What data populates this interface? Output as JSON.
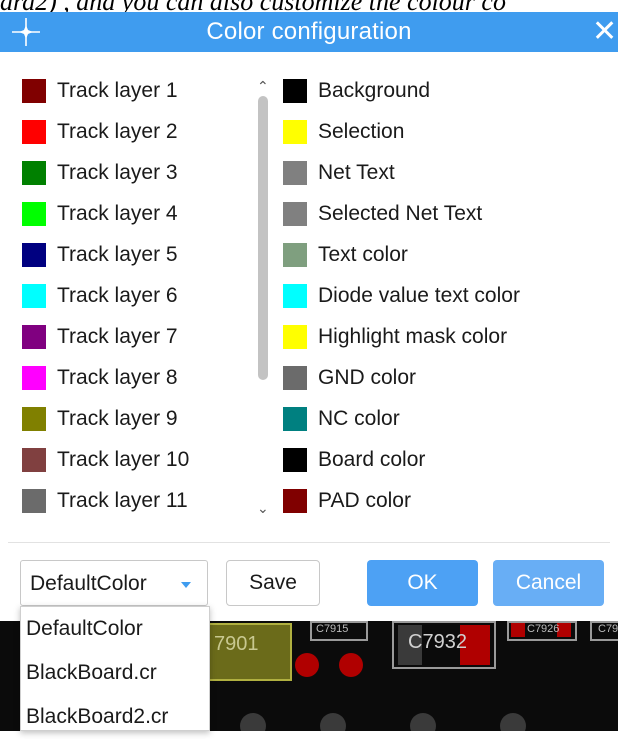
{
  "doc_text": "ard2) , and you can also customize the colour co",
  "window": {
    "title": "Color configuration",
    "close_glyph": "✕",
    "logo_icon": "crosshair-star-icon"
  },
  "left_items": [
    {
      "label": "Track layer 1",
      "color": "#800000"
    },
    {
      "label": "Track layer 2",
      "color": "#ff0000"
    },
    {
      "label": "Track layer 3",
      "color": "#008000"
    },
    {
      "label": "Track layer 4",
      "color": "#00ff00"
    },
    {
      "label": "Track layer 5",
      "color": "#000080"
    },
    {
      "label": "Track layer 6",
      "color": "#00ffff"
    },
    {
      "label": "Track layer 7",
      "color": "#800080"
    },
    {
      "label": "Track layer 8",
      "color": "#ff00ff"
    },
    {
      "label": "Track layer 9",
      "color": "#808000"
    },
    {
      "label": "Track layer 10",
      "color": "#804040"
    },
    {
      "label": "Track layer 11",
      "color": "#6b6b6b"
    }
  ],
  "right_items": [
    {
      "label": "Background",
      "color": "#000000"
    },
    {
      "label": "Selection",
      "color": "#ffff00"
    },
    {
      "label": "Net Text",
      "color": "#808080"
    },
    {
      "label": "Selected Net Text",
      "color": "#808080"
    },
    {
      "label": "Text color",
      "color": "#7f9f7f"
    },
    {
      "label": "Diode value text color",
      "color": "#00ffff"
    },
    {
      "label": "Highlight mask color",
      "color": "#ffff00"
    },
    {
      "label": "GND color",
      "color": "#6b6b6b"
    },
    {
      "label": "NC color",
      "color": "#008080"
    },
    {
      "label": "Board color",
      "color": "#000000"
    },
    {
      "label": "PAD color",
      "color": "#800000"
    }
  ],
  "scheme_select": {
    "value": "DefaultColor"
  },
  "buttons": {
    "save": "Save",
    "ok": "OK",
    "cancel": "Cancel"
  },
  "dropdown_options": [
    "DefaultColor",
    "BlackBoard.cr",
    "BlackBoard2.cr"
  ],
  "background_board": {
    "labels": [
      "7901",
      "C7915",
      "C7932",
      "C7926",
      "C79"
    ]
  }
}
